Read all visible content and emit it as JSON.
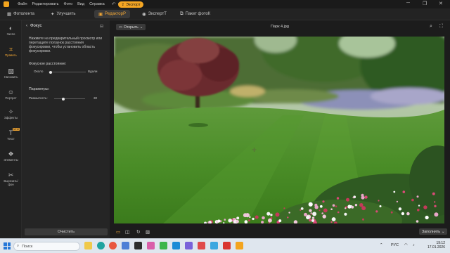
{
  "menu": {
    "items": [
      "Файл",
      "Редактировать",
      "Фото",
      "Вид",
      "Справка"
    ]
  },
  "toolbar": {
    "export_label": "Экспорт",
    "undo_icon": "undo-icon",
    "redo_icon": "redo-icon"
  },
  "tabs": [
    {
      "label": "Фотолента",
      "icon": "gallery-icon"
    },
    {
      "label": "Улучшить",
      "icon": "enhance-icon"
    },
    {
      "label": "РедакторР",
      "icon": "editor-icon",
      "active": true
    },
    {
      "label": "ЭкспертТ",
      "icon": "eye-icon"
    },
    {
      "label": "Пакет фотоК",
      "icon": "batch-icon"
    }
  ],
  "rail": [
    {
      "label": "Экспо",
      "icon": "exposure-icon"
    },
    {
      "label": "Править",
      "icon": "edit-icon",
      "active": true
    },
    {
      "label": "Наложить",
      "icon": "overlay-icon"
    },
    {
      "label": "Портрет",
      "icon": "portrait-icon"
    },
    {
      "label": "Эффекты",
      "icon": "effects-icon"
    },
    {
      "label": "Текст",
      "icon": "text-icon",
      "badge": "NEW"
    },
    {
      "label": "Элементы",
      "icon": "elements-icon"
    },
    {
      "label": "Вырезать/ фон",
      "icon": "cutout-icon"
    }
  ],
  "panel": {
    "title": "Фокус",
    "description": "Нажмите на предварительный просмотр или перетащите ползунок расстояния фокусировки, чтобы установить область фокусировки.",
    "focus_label": "Фокусное расстояние:",
    "near_label": "Около",
    "far_label": "Вдали",
    "focus_value": 0.05,
    "params_label": "Параметры:",
    "blur_label": "Размытость:",
    "blur_value": 30,
    "blur_max": 100,
    "clear_label": "Очистить"
  },
  "canvas": {
    "open_label": "Открыть",
    "filename": "Парк 4.jpg",
    "apply_label": "Заполнить"
  },
  "taskbar": {
    "search_placeholder": "Поиск",
    "lang": "РУС",
    "time": "19:12",
    "date": "17.01.2026"
  },
  "colors": {
    "accent": "#f2a734",
    "export": "#f5a623",
    "panel_bg": "#252525",
    "app_bg": "#1e1e1e"
  }
}
